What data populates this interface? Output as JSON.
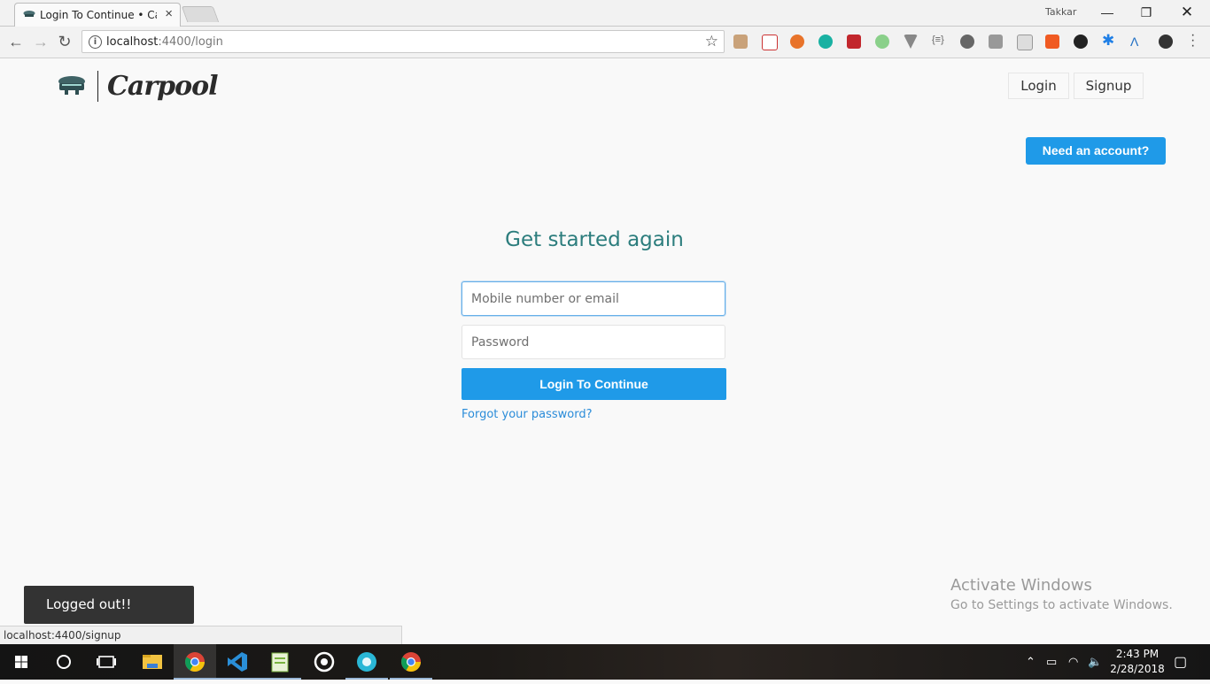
{
  "browser": {
    "tab_title": "Login To Continue • Carpool",
    "user_name": "Takkar",
    "url_host": "localhost",
    "url_rest": ":4400/login",
    "status_url": "localhost:4400/signup"
  },
  "page": {
    "logo_text": "Carpool",
    "nav": {
      "login": "Login",
      "signup": "Signup"
    },
    "need_account": "Need an account?",
    "heading": "Get started again",
    "form": {
      "identifier_placeholder": "Mobile number or email",
      "password_placeholder": "Password",
      "submit": "Login To Continue",
      "forgot": "Forgot your password?"
    },
    "toast": "Logged out!!"
  },
  "windows": {
    "activate_title": "Activate Windows",
    "activate_sub": "Go to Settings to activate Windows.",
    "time": "2:43 PM",
    "date": "2/28/2018"
  },
  "colors": {
    "accent": "#1f9ae8",
    "heading": "#2c7d7d",
    "link": "#2a8cd9"
  }
}
